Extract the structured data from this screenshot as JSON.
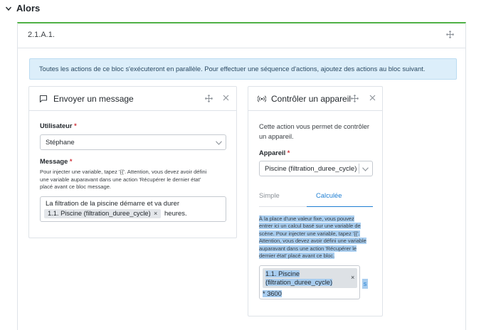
{
  "section": {
    "title": "Alors"
  },
  "block": {
    "id": "2.1.A.1.",
    "info": "Toutes les actions de ce bloc s'exécuteront en parallèle. Pour effectuer une séquence d'actions, ajoutez des actions au bloc suivant."
  },
  "message_card": {
    "title": "Envoyer un message",
    "user_label": "Utilisateur",
    "user_value": "Stéphane",
    "message_label": "Message",
    "required_mark": "*",
    "help": [
      "Pour injecter une variable, tapez '{{'. Attention, vous devez avoir défini",
      "une variable auparavant dans une action 'Récupérer le dernier état'",
      "placé avant ce bloc message."
    ],
    "message_line1": "La filtration de la piscine démarre et va durer",
    "chip": "1.1. Piscine (filtration_duree_cycle)",
    "chip_close": "×",
    "message_suffix": "heures."
  },
  "control_card": {
    "title": "Contrôler un appareil",
    "description": [
      "Cette action vous permet de contrôler",
      "un appareil."
    ],
    "device_label": "Appareil",
    "required_mark": "*",
    "device_value": "Piscine (filtration_duree_cycle)",
    "tabs": [
      "Simple",
      "Calculée"
    ],
    "active_tab": "Calculée",
    "help": [
      "À la place d'une valeur fixe, vous pouvez",
      "entrer ici un calcul basé sur une variable de",
      "scène. Pour injecter une variable, tapez '{{'.",
      "Attention, vous devez avoir défini une variable",
      "auparavant dans une action 'Récupérer le",
      "dernier état' placé avant ce bloc."
    ],
    "calc_chip_line1": "1.1. Piscine",
    "calc_chip_line2": "(filtration_duree_cycle)",
    "calc_chip_close": "×",
    "calc_expression": "* 3600",
    "calc_side": "s"
  },
  "colors": {
    "accent_green": "#4fb146",
    "info_bg": "#dceefa",
    "link_blue": "#1f7fd3",
    "required_red": "#d0333a",
    "selection_blue": "#a8cdef"
  }
}
